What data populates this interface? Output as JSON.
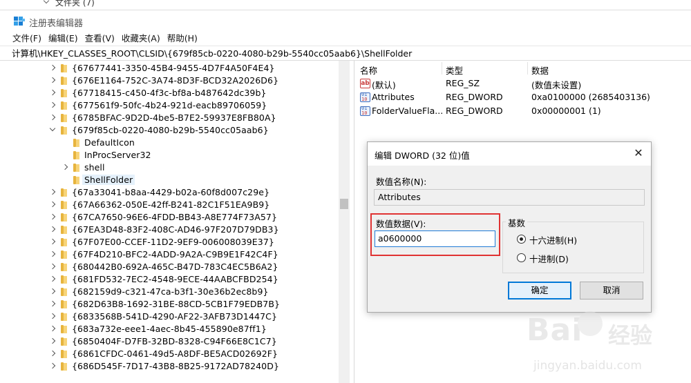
{
  "top_strip": {
    "text_left": "",
    "text_right": "文件夹 (7)"
  },
  "window": {
    "title": "注册表编辑器"
  },
  "menu": [
    "文件(F)",
    "编辑(E)",
    "查看(V)",
    "收藏夹(A)",
    "帮助(H)"
  ],
  "address": "计算机\\HKEY_CLASSES_ROOT\\CLSID\\{679f85cb-0220-4080-b29b-5540cc05aab6}\\ShellFolder",
  "tree": [
    "{67677441-3350-45B4-9455-4D7F4A50F4E4}",
    "{676E1164-752C-3A74-8D3F-BCD32A2026D6}",
    "{67718415-c450-4f3c-bf8a-b487642dc39b}",
    "{677561f9-50fc-4b24-921d-eacb89706059}",
    "{6785BFAC-9D2D-4be5-B7E2-59937E8FB80A}",
    "{679f85cb-0220-4080-b29b-5540cc05aab6}",
    "DefaultIcon",
    "InProcServer32",
    "shell",
    "ShellFolder",
    "{67a33041-b8aa-4429-b02a-60f8d007c29e}",
    "{67A66362-050E-42ff-B241-82C1F51EA9B9}",
    "{67CA7650-96E6-4FDD-BB43-A8E774F73A57}",
    "{67EA3D48-83F2-408C-AD46-97F207D79DB3}",
    "{67F07E00-CCEF-11D2-9EF9-006008039E37}",
    "{67F4D210-BFC2-4ADD-9A2A-C9B9E1F42C4F}",
    "{680442B0-692A-465C-B47D-783C4EC5B6A2}",
    "{681FD532-7EC2-4548-9ECE-44AABCFBD254}",
    "{682159d9-c321-47ca-b3f1-30e36b2ec8b9}",
    "{682D63B8-1692-31BE-88CD-5CB1F79EDB7B}",
    "{6833568B-541D-4290-AF22-3AFB73D1447C}",
    "{683a732e-eee1-4aec-8b45-455890e87ff1}",
    "{6850404F-D7FB-32BD-8328-C94F66E8C1C7}",
    "{6861CFDC-0461-49d5-A8DF-BE5ACD02692F}",
    "{686D545F-7D17-43B8-8B25-9172AD78240D}"
  ],
  "list": {
    "headers": {
      "name": "名称",
      "type": "类型",
      "data": "数据"
    },
    "rows": [
      {
        "name": "(默认)",
        "type": "REG_SZ",
        "data": "(数值未设置)"
      },
      {
        "name": "Attributes",
        "type": "REG_DWORD",
        "data": "0xa0100000 (2685403136)"
      },
      {
        "name": "FolderValueFla...",
        "type": "REG_DWORD",
        "data": "0x00000001 (1)"
      }
    ]
  },
  "dialog": {
    "title": "编辑 DWORD (32 位)值",
    "close": "✕",
    "value_name_label": "数值名称(N):",
    "value_name": "Attributes",
    "value_data_label": "数值数据(V):",
    "value_data": "a0600000",
    "base_label": "基数",
    "hex_label": "十六进制(H)",
    "dec_label": "十进制(D)",
    "hex_selected": true,
    "ok": "确定",
    "cancel": "取消"
  },
  "watermark": {
    "brand": "Bai",
    "cn": "经验",
    "url": "jingyan.baidu.com"
  }
}
